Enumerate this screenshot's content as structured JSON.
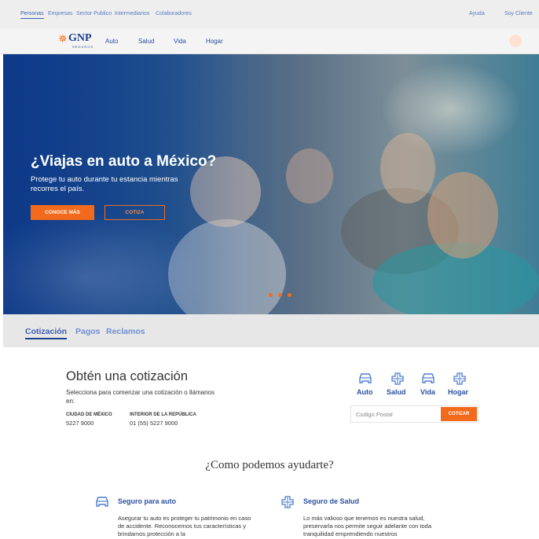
{
  "topbar": {
    "segments": [
      "Personas",
      "Empresas",
      "Sector Publico",
      "Intermediarios",
      "Colaboradores"
    ],
    "right_links": [
      "Ayuda",
      "Soy Cliente"
    ]
  },
  "nav": {
    "logo": {
      "name": "GNP",
      "sub": "SEGUROS"
    },
    "links": [
      "Auto",
      "Salud",
      "Vida",
      "Hogar"
    ]
  },
  "hero": {
    "title": "¿Viajas en auto a México?",
    "subtitle": "Protege tu auto durante tu estancia mientras recorres el país.",
    "primary_button": "CONOCE MÁS",
    "secondary_button": "COTIZA",
    "carousel_dots": 3
  },
  "tabs": [
    "Cotización",
    "Pagos",
    "Reclamos"
  ],
  "quote": {
    "title": "Obtén una cotización",
    "description": "Selecciona para comenzar una cotización o llámanos en:",
    "phones": [
      {
        "label": "CIUDAD DE MÉXICO",
        "number": "5227 9000"
      },
      {
        "label": "INTERIOR DE LA REPÚBLICA",
        "number": "01 (55) 5227 9000"
      }
    ],
    "products": [
      {
        "label": "Auto",
        "icon": "car-icon"
      },
      {
        "label": "Salud",
        "icon": "health-cross-icon"
      },
      {
        "label": "Vida",
        "icon": "car-icon"
      },
      {
        "label": "Hogar",
        "icon": "health-cross-icon"
      }
    ],
    "postal_placeholder": "Codigo Postal",
    "quote_button": "COTIZAR"
  },
  "help": {
    "title": "¿Como podemos ayudarte?",
    "services": [
      {
        "title": "Seguro para auto",
        "icon": "car-icon",
        "description": "Asegurar tu auto es proteger tu patrimonio en caso de accidente. Reconocemos tus características y brindamos protección a la"
      },
      {
        "title": "Seguro de Salud",
        "icon": "health-cross-icon",
        "description": "Lo más valioso que tenemos es nuestra salud, preservarla nos permite seguir adelante con toda tranquilidad emprendiendo nuestros"
      }
    ]
  },
  "colors": {
    "brand_blue": "#1d3f8f",
    "accent_orange": "#f26a1b",
    "link_blue": "#2d4fa0"
  }
}
